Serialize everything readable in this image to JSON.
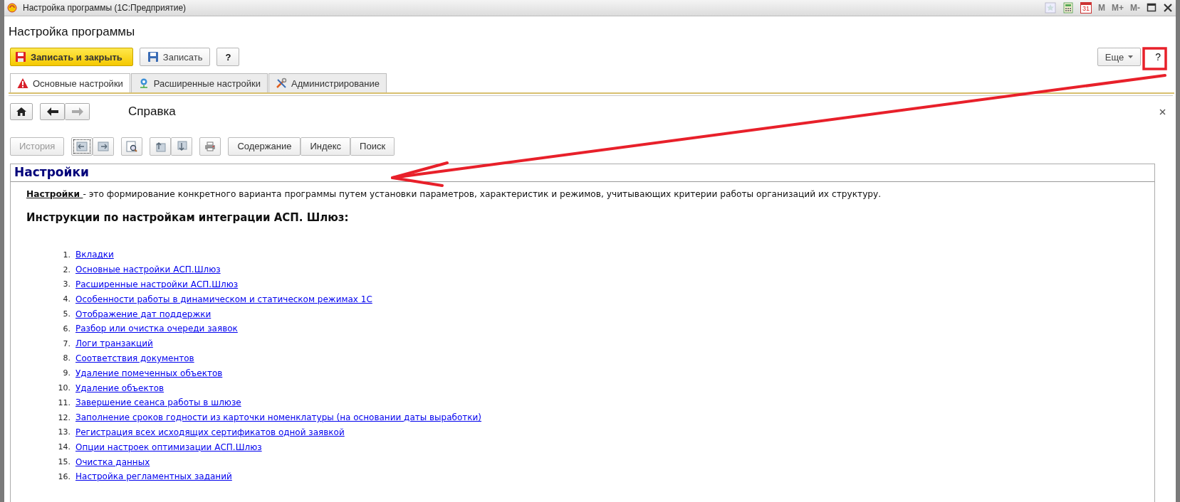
{
  "title_bar": {
    "title": "Настройка программы  (1С:Предприятие)",
    "calendar_day": "31",
    "memory_buttons": [
      "M",
      "M+",
      "M-"
    ]
  },
  "form": {
    "title": "Настройка программы",
    "buttons": [
      {
        "kind": "primary",
        "label": "Записать и закрыть"
      },
      {
        "kind": "save",
        "label": "Записать"
      },
      {
        "kind": "help",
        "label": "?"
      }
    ],
    "more_button": "Еще",
    "help_button": "?"
  },
  "tabs": [
    {
      "label": "Основные настройки",
      "kind": "warning",
      "selected": true
    },
    {
      "label": "Расширенные настройки",
      "kind": "network",
      "selected": false
    },
    {
      "label": "Администрирование",
      "kind": "tools",
      "selected": false
    }
  ],
  "help": {
    "title": "Справка",
    "history_button": "История",
    "view_buttons": [
      {
        "label": "Содержание"
      },
      {
        "label": "Индекс"
      },
      {
        "label": "Поиск"
      }
    ],
    "heading": "Настройки",
    "intro_term": "Настройки ",
    "intro_text": " - это формирование конкретного варианта программы путем установки параметров, характеристик и режимов, учитывающих критерии работы организаций их структуру.",
    "subheading": "Инструкции по настройкам интеграции АСП. Шлюз:",
    "links": [
      {
        "number": "1.",
        "label": "Вкладки"
      },
      {
        "number": "2.",
        "label": "Основные настройки АСП.Шлюз"
      },
      {
        "number": "3.",
        "label": "Расширенные настройки АСП.Шлюз"
      },
      {
        "number": "4.",
        "label": "Особенности работы в динамическом и статическом режимах 1С"
      },
      {
        "number": "5.",
        "label": "Отображение дат поддержки"
      },
      {
        "number": "6.",
        "label": "Разбор или очистка очереди заявок"
      },
      {
        "number": "7.",
        "label": "Логи транзакций"
      },
      {
        "number": "8.",
        "label": "Соответствия документов"
      },
      {
        "number": "9.",
        "label": "Удаление помеченных объектов"
      },
      {
        "number": "10.",
        "label": "Удаление объектов"
      },
      {
        "number": "11.",
        "label": "Завершение сеанса работы в шлюзе"
      },
      {
        "number": "12.",
        "label": "Заполнение сроков годности из карточки номенклатуры (на основании даты выработки)"
      },
      {
        "number": "13.",
        "label": "Регистрация всех исходящих сертификатов одной заявкой"
      },
      {
        "number": "14.",
        "label": "Опции настроек оптимизации АСП.Шлюз"
      },
      {
        "number": "15.",
        "label": "Очистка данных"
      },
      {
        "number": "16.",
        "label": "Настройка регламентных заданий"
      }
    ]
  }
}
